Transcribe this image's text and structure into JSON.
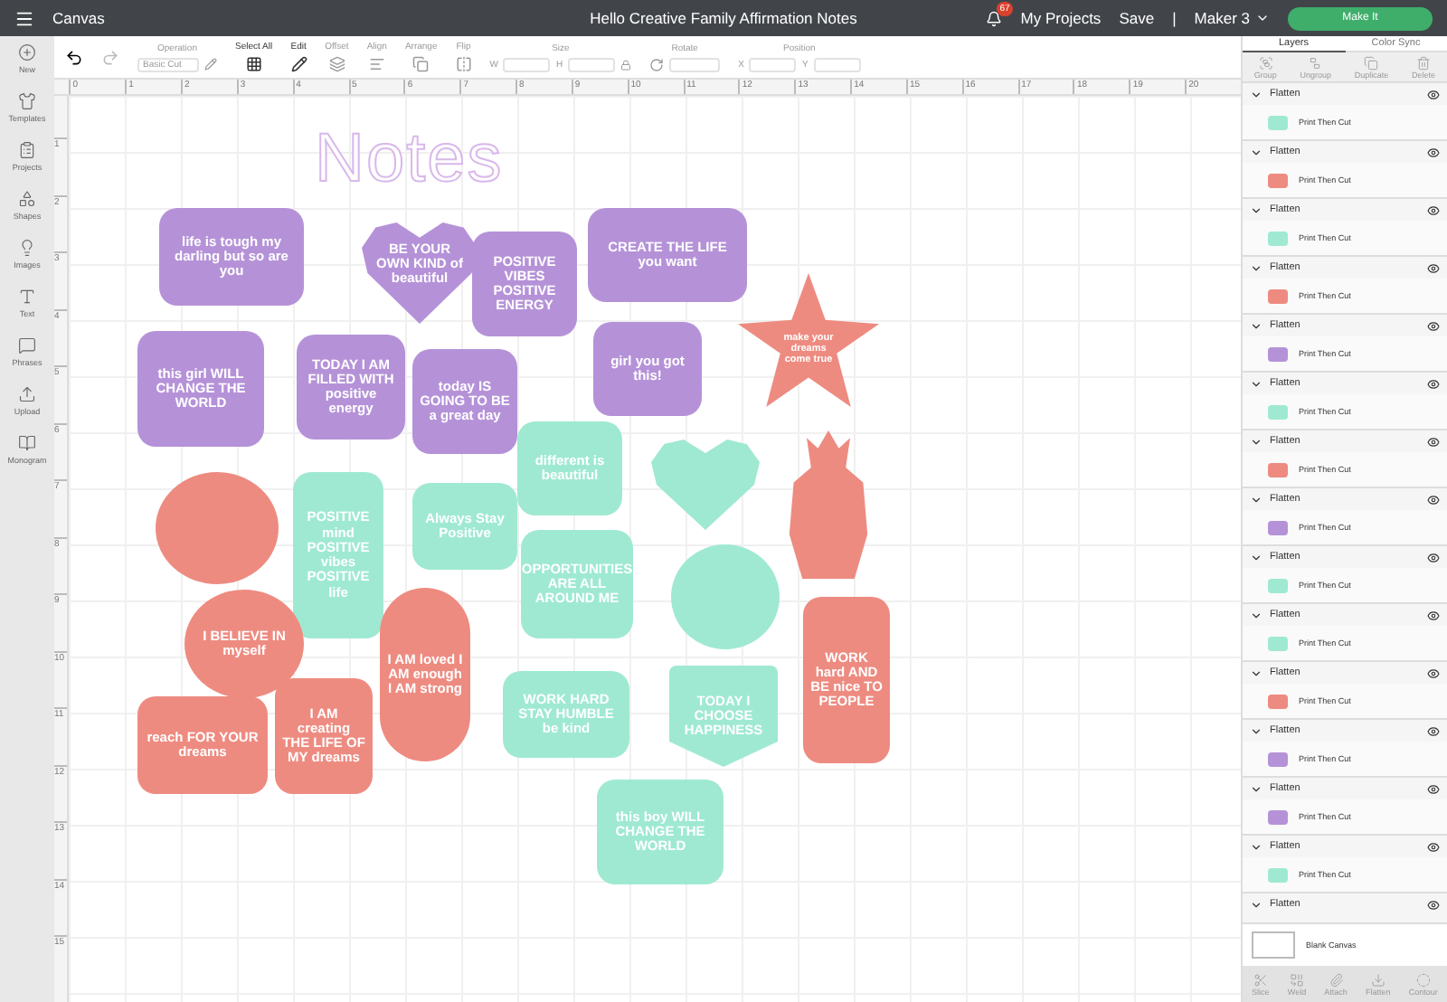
{
  "app_bar": {
    "section": "Canvas",
    "title": "Hello Creative Family Affirmation Notes",
    "notifications": "67",
    "links": [
      "My Projects",
      "Save"
    ],
    "separator": "|",
    "machine": "Maker 3",
    "make_button": "Make It"
  },
  "sidebar": [
    {
      "label": "New"
    },
    {
      "label": "Templates"
    },
    {
      "label": "Projects"
    },
    {
      "label": "Shapes"
    },
    {
      "label": "Images"
    },
    {
      "label": "Text"
    },
    {
      "label": "Phrases"
    },
    {
      "label": "Upload"
    },
    {
      "label": "Monogram"
    }
  ],
  "toolbar": {
    "tools": [
      {
        "kind": "select",
        "label": "Operation",
        "value": "Basic Cut",
        "disabled": true
      },
      {
        "kind": "icon",
        "label": "Select All",
        "disabled": false
      },
      {
        "kind": "icon",
        "label": "Edit",
        "disabled": false
      },
      {
        "kind": "icon",
        "label": "Offset",
        "disabled": true
      },
      {
        "kind": "icon",
        "label": "Align",
        "disabled": true
      },
      {
        "kind": "icon",
        "label": "Arrange",
        "disabled": true
      },
      {
        "kind": "icon",
        "label": "Flip",
        "disabled": true
      },
      {
        "kind": "pair",
        "label": "Size",
        "fields": [
          "W",
          "H"
        ],
        "disabled": true
      },
      {
        "kind": "single",
        "label": "Rotate",
        "disabled": true
      },
      {
        "kind": "pair",
        "label": "Position",
        "fields": [
          "X",
          "Y"
        ],
        "disabled": true
      }
    ]
  },
  "ruler": {
    "horizontal": [
      "0",
      "1",
      "2",
      "3",
      "4",
      "5",
      "6",
      "7",
      "8",
      "9",
      "10",
      "11",
      "12",
      "13",
      "14",
      "15",
      "16",
      "17",
      "18",
      "19",
      "20"
    ],
    "vertical": [
      "1",
      "2",
      "3",
      "4",
      "5",
      "6",
      "7",
      "8",
      "9",
      "10",
      "11",
      "12",
      "13",
      "14",
      "15"
    ]
  },
  "canvas": {
    "heading": "Notes",
    "stickers": [
      {
        "kind": "rounded",
        "color": "#b592d8",
        "text": "life is tough my darling but so are you"
      },
      {
        "kind": "heart",
        "color": "#b592d8",
        "text": "BE YOUR OWN KIND of beautiful"
      },
      {
        "kind": "rounded",
        "color": "#b592d8",
        "text": "POSITIVE VIBES POSITIVE ENERGY"
      },
      {
        "kind": "rounded",
        "color": "#b592d8",
        "text": "CREATE THE LIFE you want"
      },
      {
        "kind": "star",
        "color": "#ee8b81",
        "text": "make your dreams come true"
      },
      {
        "kind": "rounded",
        "color": "#b592d8",
        "text": "this girl WILL CHANGE THE WORLD"
      },
      {
        "kind": "rounded",
        "color": "#b592d8",
        "text": "TODAY I AM FILLED WITH positive energy"
      },
      {
        "kind": "rounded",
        "color": "#b592d8",
        "text": "today IS GOING TO BE a great day"
      },
      {
        "kind": "rounded",
        "color": "#b592d8",
        "text": "girl you got this!"
      },
      {
        "kind": "rounded",
        "color": "#9fe9d2",
        "text": "different is beautiful"
      },
      {
        "kind": "heart",
        "color": "#9fe9d2"
      },
      {
        "kind": "pineapple",
        "color": "#ee8b81"
      },
      {
        "kind": "circle",
        "color": "#ee8b81"
      },
      {
        "kind": "rounded",
        "color": "#9fe9d2",
        "text": "POSITIVE mind POSITIVE vibes POSITIVE life"
      },
      {
        "kind": "rounded",
        "color": "#9fe9d2",
        "text": "Always Stay Positive"
      },
      {
        "kind": "rounded",
        "color": "#9fe9d2",
        "text": "OPPORTUNITIES ARE ALL AROUND ME"
      },
      {
        "kind": "circle",
        "color": "#9fe9d2"
      },
      {
        "kind": "circle",
        "color": "#ee8b81",
        "text": "I BELIEVE IN myself"
      },
      {
        "kind": "pill",
        "color": "#ee8b81",
        "text": "I AM loved I AM enough I AM strong"
      },
      {
        "kind": "rounded",
        "color": "#ee8b81",
        "text": "WORK hard AND BE nice TO PEOPLE"
      },
      {
        "kind": "rounded",
        "color": "#9fe9d2",
        "text": "WORK HARD STAY HUMBLE be kind"
      },
      {
        "kind": "badge",
        "color": "#9fe9d2",
        "text": "TODAY I CHOOSE HAPPINESS"
      },
      {
        "kind": "rounded",
        "color": "#ee8b81",
        "text": "reach FOR YOUR dreams"
      },
      {
        "kind": "rounded",
        "color": "#ee8b81",
        "text": "I AM creating THE LIFE OF MY dreams"
      },
      {
        "kind": "rounded",
        "color": "#9fe9d2",
        "text": "this boy WILL CHANGE THE WORLD"
      }
    ]
  },
  "layers_panel": {
    "tabs": [
      {
        "label": "Layers",
        "selected": true
      },
      {
        "label": "Color Sync",
        "selected": false
      }
    ],
    "actions": [
      {
        "label": "Group",
        "disabled": true
      },
      {
        "label": "Ungroup",
        "disabled": true
      },
      {
        "label": "Duplicate",
        "disabled": true
      },
      {
        "label": "Delete",
        "disabled": true
      }
    ],
    "layers": [
      {
        "name": "Flatten",
        "item": "Print Then Cut",
        "color": "#9fe9d2"
      },
      {
        "name": "Flatten",
        "item": "Print Then Cut",
        "color": "#ee8b81"
      },
      {
        "name": "Flatten",
        "item": "Print Then Cut",
        "color": "#9fe9d2"
      },
      {
        "name": "Flatten",
        "item": "Print Then Cut",
        "color": "#ee8b81"
      },
      {
        "name": "Flatten",
        "item": "Print Then Cut",
        "color": "#b592d8"
      },
      {
        "name": "Flatten",
        "item": "Print Then Cut",
        "color": "#9fe9d2"
      },
      {
        "name": "Flatten",
        "item": "Print Then Cut",
        "color": "#ee8b81"
      },
      {
        "name": "Flatten",
        "item": "Print Then Cut",
        "color": "#b592d8"
      },
      {
        "name": "Flatten",
        "item": "Print Then Cut",
        "color": "#9fe9d2"
      },
      {
        "name": "Flatten",
        "item": "Print Then Cut",
        "color": "#9fe9d2"
      },
      {
        "name": "Flatten",
        "item": "Print Then Cut",
        "color": "#ee8b81"
      },
      {
        "name": "Flatten",
        "item": "Print Then Cut",
        "color": "#b592d8"
      },
      {
        "name": "Flatten",
        "item": "Print Then Cut",
        "color": "#b592d8"
      },
      {
        "name": "Flatten",
        "item": "Print Then Cut",
        "color": "#9fe9d2"
      },
      {
        "name": "Flatten"
      }
    ],
    "blank_canvas": "Blank Canvas",
    "bottom_actions": [
      {
        "label": "Slice",
        "disabled": true
      },
      {
        "label": "Weld",
        "disabled": true
      },
      {
        "label": "Attach",
        "disabled": true
      },
      {
        "label": "Flatten",
        "disabled": true
      },
      {
        "label": "Contour",
        "disabled": true
      }
    ]
  }
}
